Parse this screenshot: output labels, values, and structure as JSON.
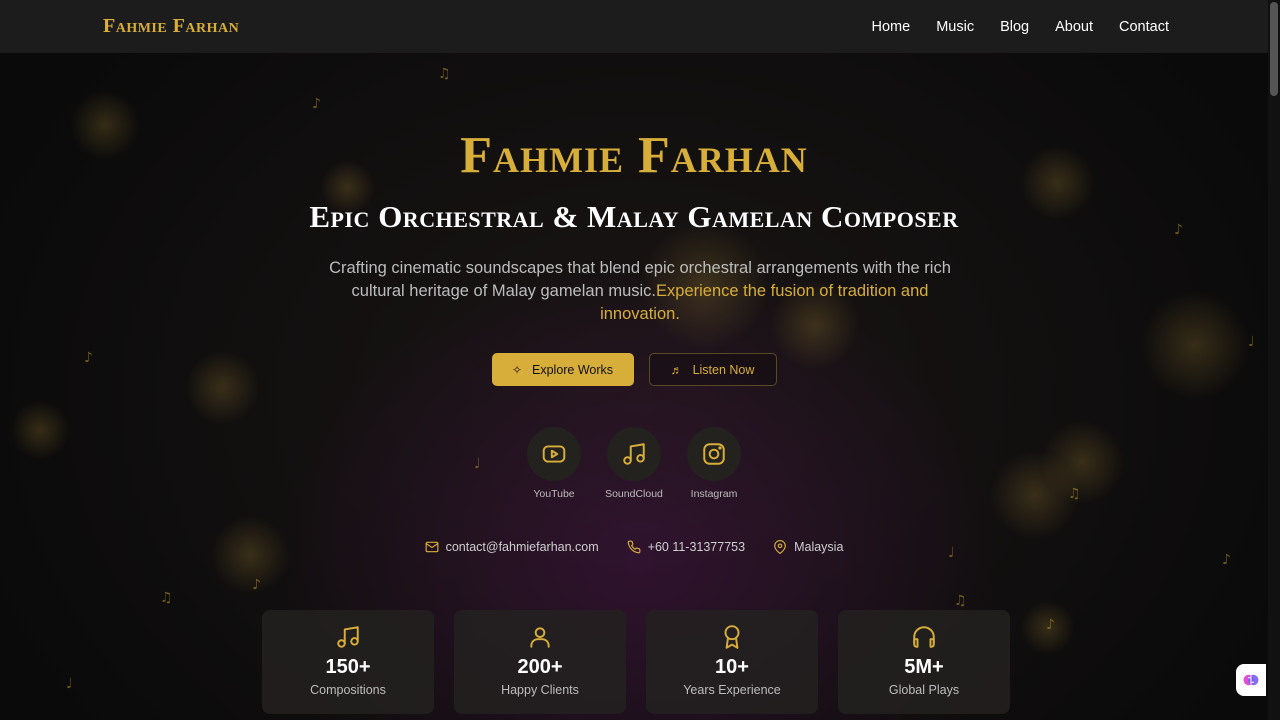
{
  "brand": "Fahmie Farhan",
  "nav": [
    "Home",
    "Music",
    "Blog",
    "About",
    "Contact"
  ],
  "hero": {
    "title": "Fahmie Farhan",
    "subtitle": "Epic Orchestral & Malay Gamelan Composer",
    "description": "Crafting cinematic soundscapes that blend epic orchestral arrangements with the rich cultural heritage of Malay gamelan music.",
    "highlight": "Experience the fusion of tradition and innovation."
  },
  "buttons": {
    "primary": "Explore Works",
    "secondary": "Listen Now"
  },
  "socials": [
    {
      "label": "YouTube",
      "icon": "youtube-icon"
    },
    {
      "label": "SoundCloud",
      "icon": "music-note-icon"
    },
    {
      "label": "Instagram",
      "icon": "instagram-icon"
    }
  ],
  "contacts": {
    "email": "contact@fahmiefarhan.com",
    "phone": "+60 11-31377753",
    "location": "Malaysia"
  },
  "stats": [
    {
      "value": "150+",
      "label": "Compositions",
      "icon": "music-note-icon"
    },
    {
      "value": "200+",
      "label": "Happy Clients",
      "icon": "user-icon"
    },
    {
      "value": "10+",
      "label": "Years Experience",
      "icon": "award-icon"
    },
    {
      "value": "5M+",
      "label": "Global Plays",
      "icon": "headphones-icon"
    }
  ],
  "colors": {
    "accent": "#d8ae3a",
    "background": "#0c0b0b",
    "navbar": "#1c1c1c"
  }
}
